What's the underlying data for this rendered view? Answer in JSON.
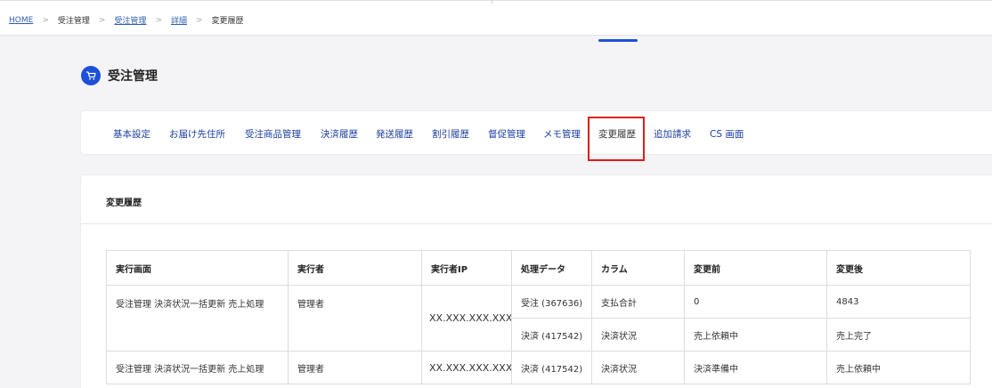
{
  "breadcrumb": {
    "home": "HOME",
    "order_mgmt": "受注管理",
    "order_mgmt_link": "受注管理",
    "detail": "詳細",
    "current": "変更履歴",
    "separator": ">"
  },
  "page": {
    "title": "受注管理",
    "icon": "cart-icon",
    "accent_color": "#1d4fd8"
  },
  "tabs": [
    {
      "label": "基本設定"
    },
    {
      "label": "お届け先住所"
    },
    {
      "label": "受注商品管理"
    },
    {
      "label": "決済履歴"
    },
    {
      "label": "発送履歴"
    },
    {
      "label": "割引履歴"
    },
    {
      "label": "督促管理"
    },
    {
      "label": "メモ管理"
    },
    {
      "label": "変更履歴",
      "active": true
    },
    {
      "label": "追加請求"
    },
    {
      "label": "CS 画面"
    }
  ],
  "history": {
    "title": "変更履歴",
    "columns": [
      "実行画面",
      "実行者",
      "実行者IP",
      "処理データ",
      "カラム",
      "変更前",
      "変更後"
    ],
    "rows": [
      {
        "screen": "受注管理 決済状況一括更新 売上処理",
        "executor": "管理者",
        "ip": "XX.XXX.XXX.XXX",
        "changes": [
          {
            "data": "受注 (367636)",
            "column": "支払合計",
            "before": "0",
            "after": "4843"
          },
          {
            "data": "決済 (417542)",
            "column": "決済状況",
            "before": "売上依頼中",
            "after": "売上完了"
          }
        ]
      },
      {
        "screen": "受注管理 決済状況一括更新 売上処理",
        "executor": "管理者",
        "ip": "XX.XXX.XXX.XXX",
        "changes": [
          {
            "data": "決済 (417542)",
            "column": "決済状況",
            "before": "決済準備中",
            "after": "売上依頼中"
          }
        ]
      }
    ]
  }
}
